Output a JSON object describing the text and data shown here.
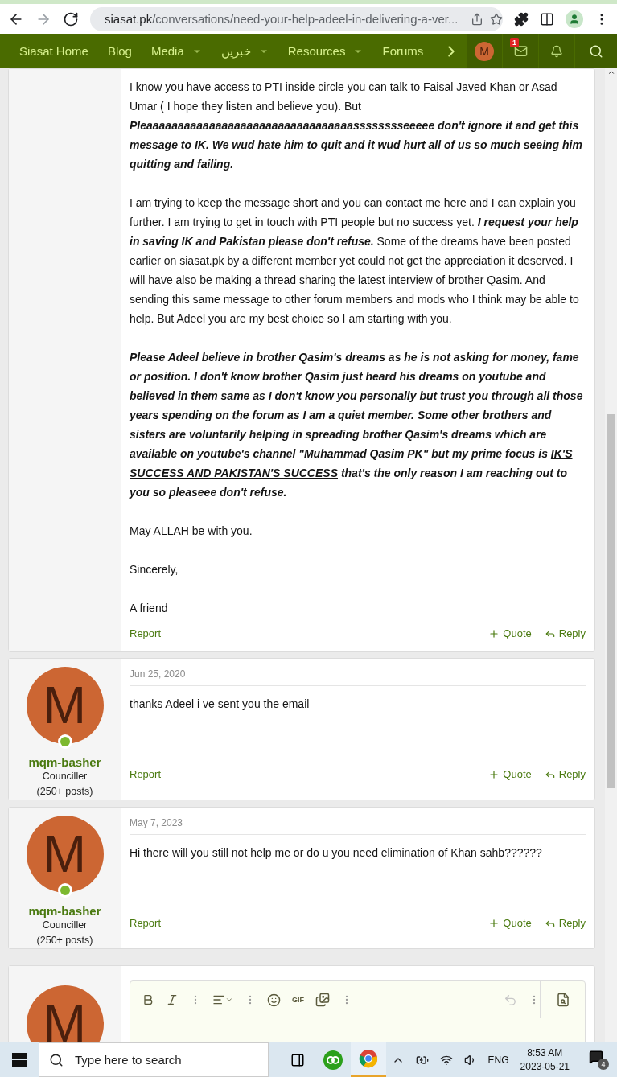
{
  "browser": {
    "buttons": [
      {
        "kind": "back",
        "disabled": false
      },
      {
        "kind": "forward",
        "disabled": true
      },
      {
        "kind": "reload",
        "disabled": false
      }
    ],
    "url_host": "siasat.pk",
    "url_path": "/conversations/need-your-help-adeel-in-delivering-a-ver..."
  },
  "nav": {
    "items": [
      {
        "label": "Siasat Home",
        "dropdown": false
      },
      {
        "label": "Blog",
        "dropdown": false
      },
      {
        "label": "Media",
        "dropdown": true
      },
      {
        "label": "خبریں",
        "dropdown": true
      },
      {
        "label": "Resources",
        "dropdown": true
      },
      {
        "label": "Forums",
        "dropdown": false
      }
    ],
    "user_initial": "M",
    "inbox_badge": "1"
  },
  "posts": [
    {
      "paragraphs": [
        [
          {
            "kind": "plain",
            "text": "I know you have access to PTI inside circle you can talk to Faisal Javed Khan or Asad Umar ( I hope they listen and believe you). But "
          },
          {
            "kind": "emphasis",
            "text": "Pleaaaaaaaaaaaaaaaaaaaaaaaaaaaaaaaaasssssssseeeee don't ignore it and get this message to IK. We wud hate him to quit and it wud hurt all of us so much seeing him quitting and failing."
          }
        ],
        [
          {
            "kind": "plain",
            "text": "I am trying to keep the message short and you can contact me here and I can explain you further. I am trying to get in touch with PTI people but no success yet. "
          },
          {
            "kind": "emphasis",
            "text": "I request your help in saving IK and Pakistan please don't refuse."
          },
          {
            "kind": "plain",
            "text": " Some of the dreams have been posted earlier on siasat.pk by a different member yet could not get the appreciation it deserved. I will have also be making a thread sharing the latest interview of brother Qasim. And sending this same message to other forum members and mods who I think may be able to help. But Adeel you are my best choice so I am starting with you."
          }
        ],
        [
          {
            "kind": "emphasis",
            "text": "Please Adeel believe in brother Qasim's dreams as he is not asking for money, fame or position. I don't know brother Qasim just heard his dreams on youtube and believed in them same as I don't know you personally but trust you through all those years spending on the forum as I am a quiet member. Some other brothers and sisters are voluntarily helping in spreading brother Qasim's dreams which are available on youtube's channel \"Muhammad Qasim PK\" but my prime focus is "
          },
          {
            "kind": "underline",
            "text": "IK'S SUCCESS AND PAKISTAN'S SUCCESS"
          },
          {
            "kind": "emphasis",
            "text": " that's the only reason I am reaching out to you so pleaseee don't refuse."
          }
        ],
        [
          {
            "kind": "plain",
            "text": "May ALLAH be with you."
          }
        ],
        [
          {
            "kind": "plain",
            "text": "Sincerely,"
          }
        ],
        [
          {
            "kind": "plain",
            "text": "A friend"
          }
        ]
      ],
      "report": "Report",
      "quote": "Quote",
      "reply": "Reply"
    },
    {
      "author": {
        "initial": "M",
        "name": "mqm-basher",
        "title": "Counciller (250+ posts)"
      },
      "date": "Jun 25, 2020",
      "paragraphs": [
        [
          {
            "kind": "plain",
            "text": "thanks Adeel i ve sent you the email"
          }
        ]
      ],
      "report": "Report",
      "quote": "Quote",
      "reply": "Reply"
    },
    {
      "author": {
        "initial": "M",
        "name": "mqm-basher",
        "title": "Counciller (250+ posts)"
      },
      "date": "May 7, 2023",
      "paragraphs": [
        [
          {
            "kind": "plain",
            "text": "Hi there will you still not help me or do u you need elimination of Khan sahb??????"
          }
        ]
      ],
      "report": "Report",
      "quote": "Quote",
      "reply": "Reply"
    }
  ],
  "editor": {
    "avatar_initial": "M",
    "gif": "GIF",
    "undo_disabled": true
  },
  "taskbar": {
    "search_placeholder": "Type here to search",
    "language": "ENG",
    "time": "8:53 AM",
    "date": "2023-05-21",
    "notifications": "4"
  }
}
